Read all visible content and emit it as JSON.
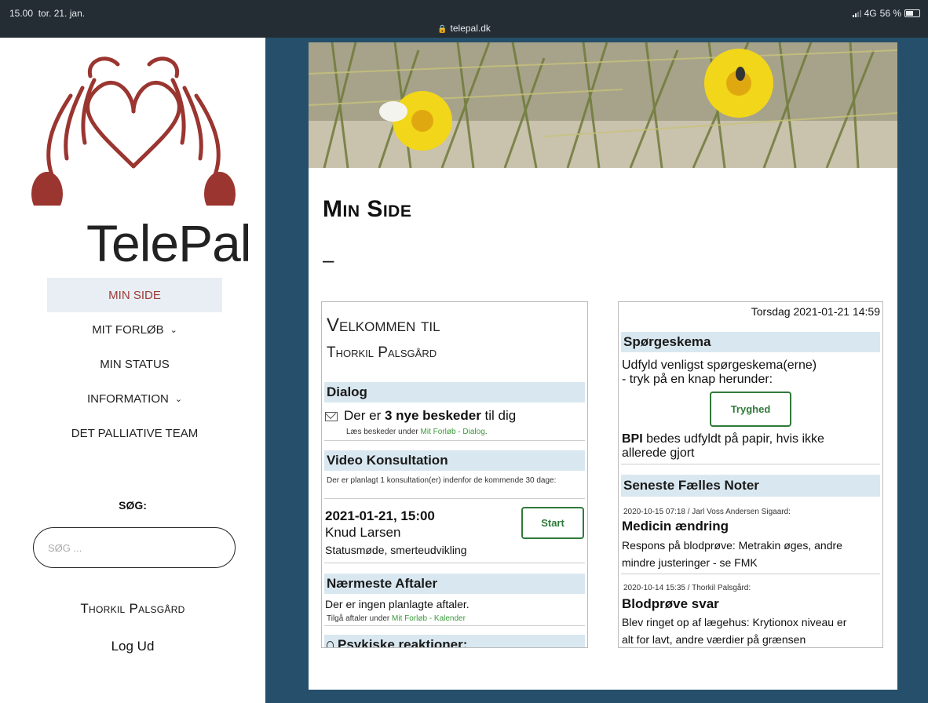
{
  "status_bar": {
    "time": "15.00",
    "date": "tor. 21. jan.",
    "url": "telepal.dk",
    "network": "4G",
    "battery": "56 %",
    "battery_level": 0.56
  },
  "sidebar": {
    "logo_text": "TelePal",
    "nav": [
      {
        "label": "MIN SIDE"
      },
      {
        "label": "MIT FORLØB"
      },
      {
        "label": "MIN STATUS"
      },
      {
        "label": "INFORMATION"
      },
      {
        "label": "DET PALLIATIVE TEAM"
      }
    ],
    "search_label": "SØG:",
    "search_placeholder": "SØG ...",
    "user_name": "Thorkil Palsgård",
    "logout": "Log Ud"
  },
  "main": {
    "page_title": "Min Side",
    "dash": "–",
    "left": {
      "welcome_line1": "Velkommen til",
      "welcome_line2": "Thorkil Palsgård",
      "dialog": {
        "heading": "Dialog",
        "msg_prefix": "Der er ",
        "msg_bold": "3 nye beskeder",
        "msg_suffix": " til dig",
        "note_prefix": "Læs beskeder under ",
        "note_link": "Mit Forløb - Dialog",
        "note_suffix": "."
      },
      "video": {
        "heading": "Video Konsultation",
        "note": "Der er planlagt 1 konsultation(er) indenfor de kommende 30 dage:",
        "datetime": "2021-01-21, 15:00",
        "person": "Knud Larsen",
        "topic": "Statusmøde, smerteudvikling",
        "start_label": "Start"
      },
      "appointments": {
        "heading": "Nærmeste Aftaler",
        "text": "Der er ingen planlagte aftaler.",
        "note_prefix": "Tilgå aftaler under ",
        "note_link": "Mit Forløb - Kalender"
      },
      "psych": {
        "heading": "Psykiske reaktioner:"
      }
    },
    "right": {
      "datetime": "Torsdag 2021-01-21 14:59",
      "questionnaire": {
        "heading": "Spørgeskema",
        "text_line1": "Udfyld venligst spørgeskema(erne)",
        "text_line2": "- tryk på en knap herunder:",
        "button_label": "Tryghed",
        "bpi_bold": "BPI",
        "bpi_line1": " bedes udfyldt på papir, hvis ikke",
        "bpi_line2": "allerede gjort"
      },
      "notes": {
        "heading": "Seneste Fælles Noter",
        "items": [
          {
            "meta": "2020-10-15 07:18 / Jarl Voss Andersen Sigaard:",
            "title": "Medicin ændring",
            "body_line1": "Respons på blodprøve: Metrakin øges, andre",
            "body_line2": "mindre justeringer - se FMK"
          },
          {
            "meta": "2020-10-14 15:35 / Thorkil Palsgård:",
            "title": "Blodprøve svar",
            "body_line1": "Blev ringet op af lægehus: Krytionox niveau er",
            "body_line2": "alt for lavt, andre værdier på grænsen"
          }
        ]
      }
    }
  }
}
